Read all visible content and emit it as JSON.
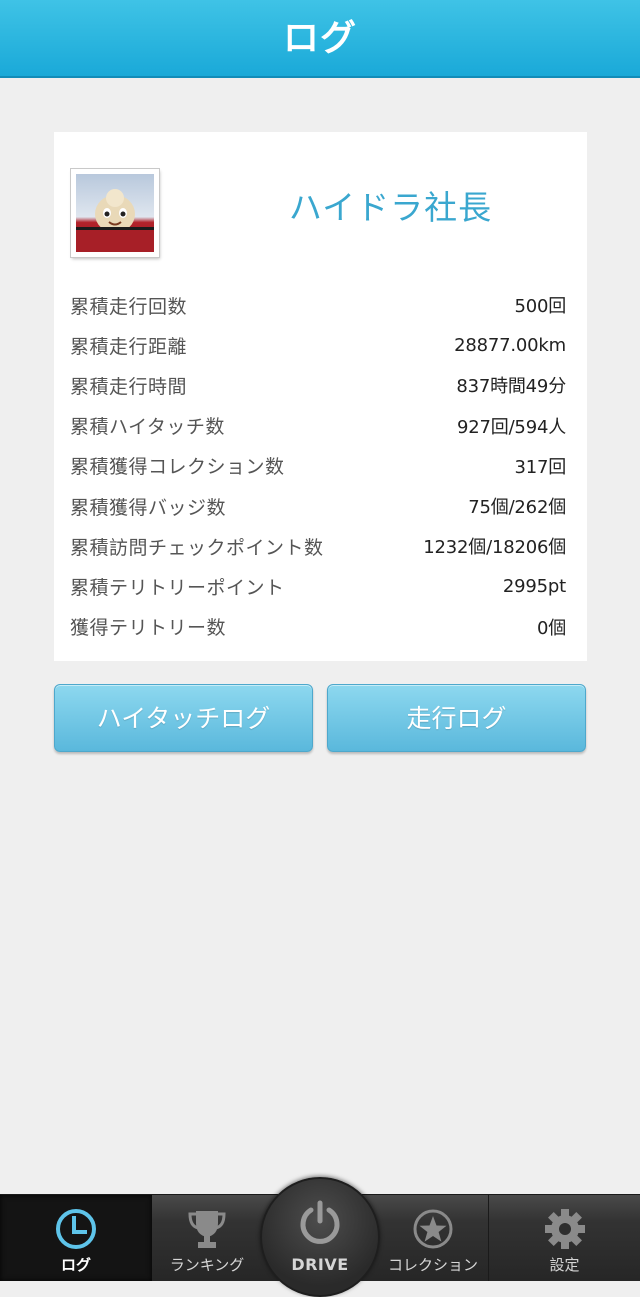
{
  "header": {
    "title": "ログ"
  },
  "profile": {
    "name": "ハイドラ社長",
    "avatar_icon": "mascot-photo"
  },
  "stats": [
    {
      "label": "累積走行回数",
      "value": "500回"
    },
    {
      "label": "累積走行距離",
      "value": "28877.00km"
    },
    {
      "label": "累積走行時間",
      "value": "837時間49分"
    },
    {
      "label": "累積ハイタッチ数",
      "value": "927回/594人"
    },
    {
      "label": "累積獲得コレクション数",
      "value": "317回"
    },
    {
      "label": "累積獲得バッジ数",
      "value": "75個/262個"
    },
    {
      "label": "累積訪問チェックポイント数",
      "value": "1232個/18206個"
    },
    {
      "label": "累積テリトリーポイント",
      "value": "2995pt"
    },
    {
      "label": "獲得テリトリー数",
      "value": "0個"
    }
  ],
  "buttons": {
    "hightouch_log": "ハイタッチログ",
    "drive_log": "走行ログ"
  },
  "tabbar": {
    "log": {
      "label": "ログ",
      "icon": "clock-icon"
    },
    "ranking": {
      "label": "ランキング",
      "icon": "trophy-icon"
    },
    "drive": {
      "label": "DRIVE",
      "icon": "power-icon"
    },
    "collection": {
      "label": "コレクション",
      "icon": "star-icon"
    },
    "settings": {
      "label": "設定",
      "icon": "gear-icon"
    }
  },
  "colors": {
    "header": "#2bb6e0",
    "accent_text": "#3aa7cf",
    "button": "#6cc6e6",
    "tabbar": "#333333",
    "background": "#efefef"
  }
}
